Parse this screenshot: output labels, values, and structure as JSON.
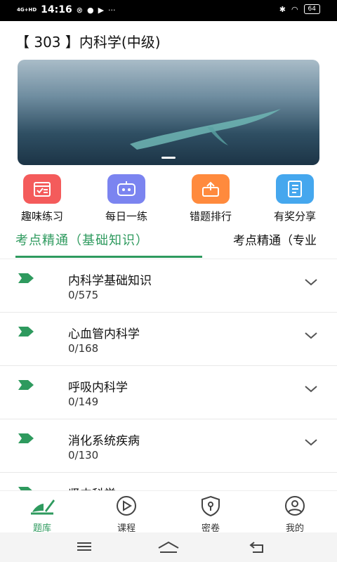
{
  "status_bar": {
    "network": "4G+HD",
    "time": "14:16",
    "battery": "64"
  },
  "header": {
    "title": "【 303 】内科学(中级)"
  },
  "quick_actions": [
    {
      "label": "趣味练习",
      "icon": "calendar-check-icon",
      "color": "#f45b5b"
    },
    {
      "label": "每日一练",
      "icon": "robot-icon",
      "color": "#7b84f0"
    },
    {
      "label": "错题排行",
      "icon": "upload-box-icon",
      "color": "#ff8a3d"
    },
    {
      "label": "有奖分享",
      "icon": "notebook-icon",
      "color": "#45a7ee"
    }
  ],
  "tabs": [
    {
      "label": "考点精通（基础知识）",
      "active": true
    },
    {
      "label": "考点精通（专业",
      "active": false
    }
  ],
  "chapters": [
    {
      "name": "内科学基础知识",
      "progress": "0/575"
    },
    {
      "name": "心血管内科学",
      "progress": "0/168"
    },
    {
      "name": "呼吸内科学",
      "progress": "0/149"
    },
    {
      "name": "消化系统疾病",
      "progress": "0/130"
    },
    {
      "name": "肾内科学",
      "progress": ""
    }
  ],
  "bottom_nav": [
    {
      "label": "题库",
      "icon": "question-bank-icon",
      "active": true
    },
    {
      "label": "课程",
      "icon": "play-icon",
      "active": false
    },
    {
      "label": "密卷",
      "icon": "lock-shield-icon",
      "active": false
    },
    {
      "label": "我的",
      "icon": "user-icon",
      "active": false
    }
  ],
  "colors": {
    "accent": "#2e9a5e"
  }
}
